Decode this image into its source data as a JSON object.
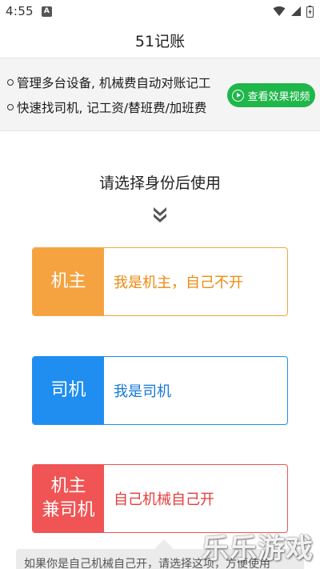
{
  "status_bar": {
    "time": "4:55",
    "notification_icon": "a-icon"
  },
  "header": {
    "title": "51记账"
  },
  "banner": {
    "line1": "管理多台设备, 机械费自动对账记工",
    "line2": "快速找司机, 记工资/替班费/加班费",
    "video_button": "查看效果视频"
  },
  "prompt": "请选择身份后使用",
  "roles": {
    "owner": {
      "tag": "机主",
      "desc": "我是机主，自己不开"
    },
    "driver": {
      "tag": "司机",
      "desc": "我是司机"
    },
    "both": {
      "tag_line1": "机主",
      "tag_line2": "兼司机",
      "desc": "自己机械自己开"
    }
  },
  "tooltip": "如果你是自己机械自己开，请选择这项，方便使用",
  "watermark": "乐乐游戏",
  "colors": {
    "owner": "#f5a340",
    "driver": "#1f8ef0",
    "both": "#f05454",
    "video_button": "#1fb64a"
  }
}
